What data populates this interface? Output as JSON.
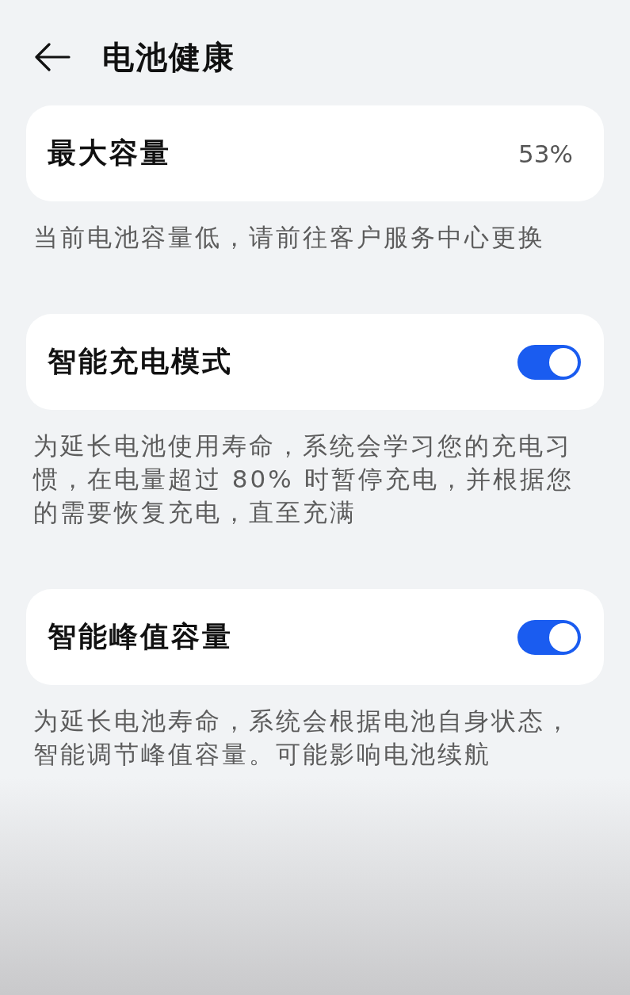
{
  "header": {
    "title": "电池健康"
  },
  "sections": [
    {
      "kind": "value",
      "label": "最大容量",
      "value": "53%",
      "description": "当前电池容量低，请前往客户服务中心更换"
    },
    {
      "kind": "toggle",
      "label": "智能充电模式",
      "on": true,
      "description": "为延长电池使用寿命，系统会学习您的充电习惯，在电量超过 80% 时暂停充电，并根据您的需要恢复充电，直至充满"
    },
    {
      "kind": "toggle",
      "label": "智能峰值容量",
      "on": true,
      "description": "为延长电池寿命，系统会根据电池自身状态，智能调节峰值容量。可能影响电池续航"
    }
  ]
}
